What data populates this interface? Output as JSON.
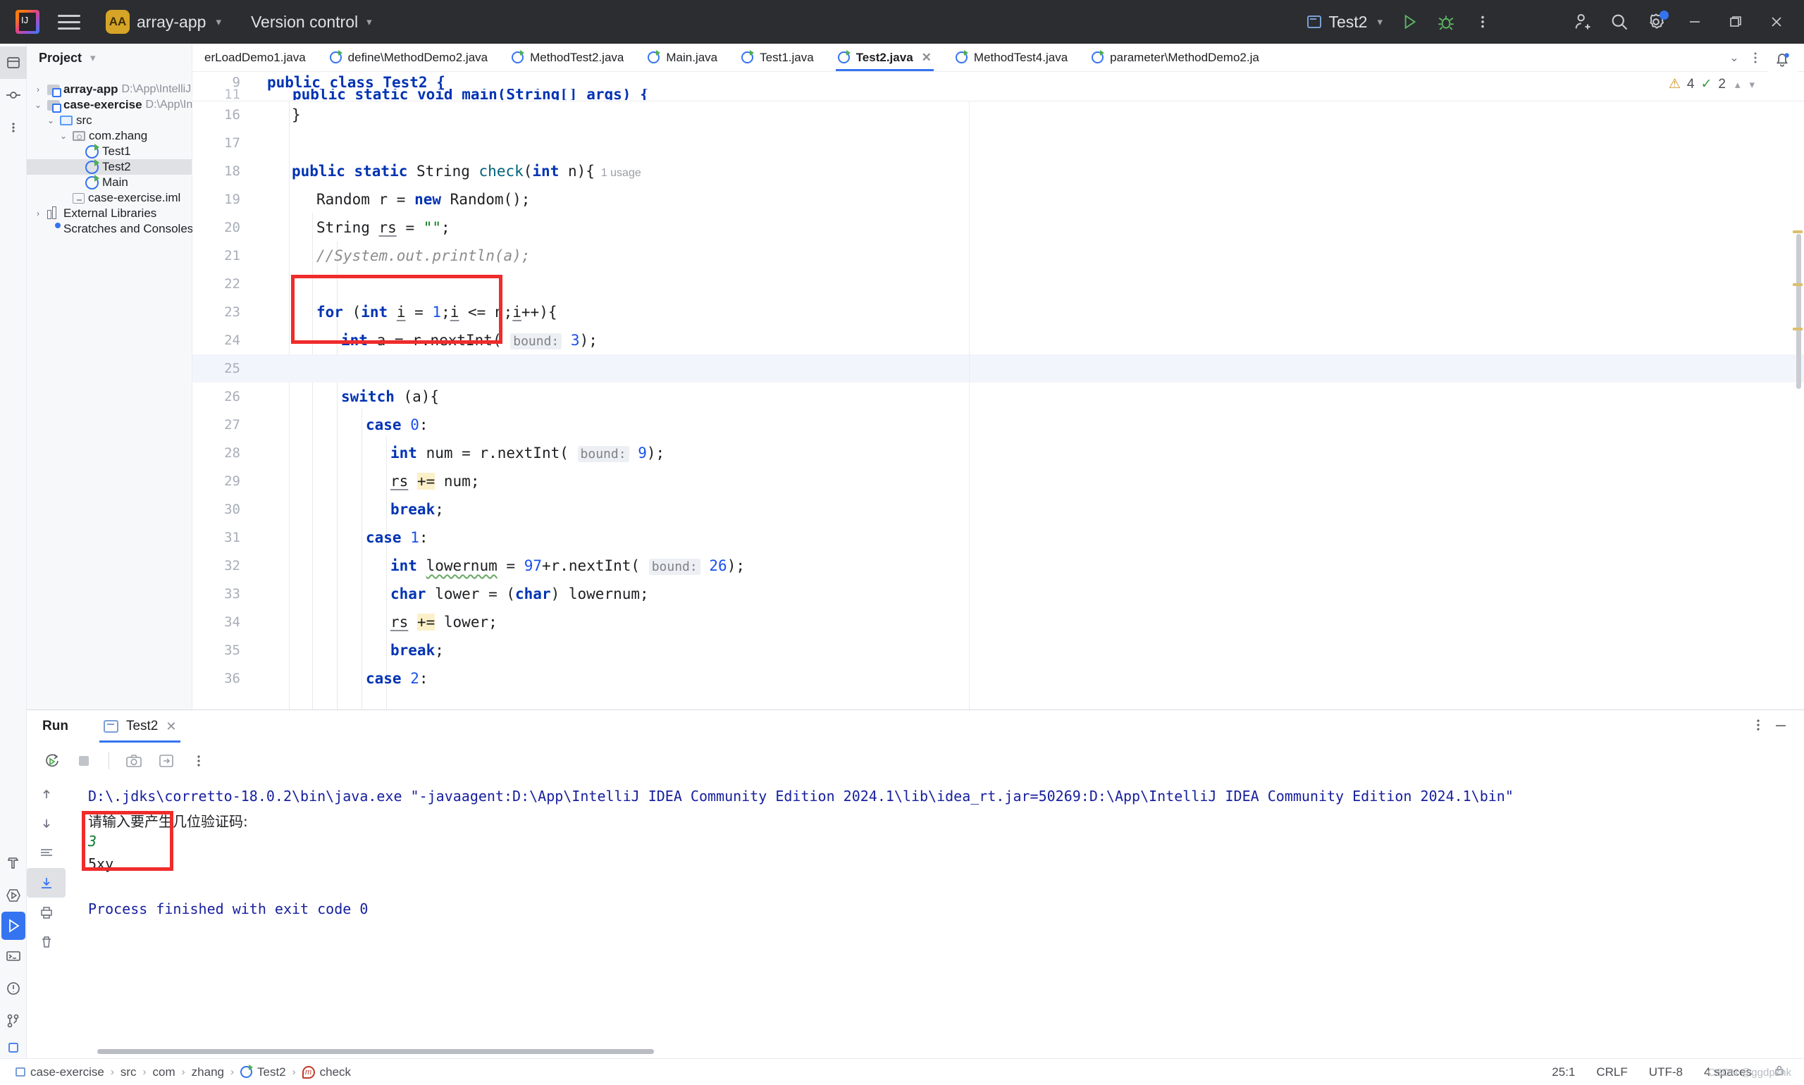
{
  "titlebar": {
    "logo_text": "IJ",
    "project_badge": "AA",
    "project_name": "array-app",
    "vcs_label": "Version control",
    "run_config": "Test2",
    "icons": [
      "burger-icon",
      "project-chevron-icon",
      "vcs-chevron-icon",
      "run-icon",
      "debug-icon",
      "more-vert-icon",
      "add-user-icon",
      "search-icon",
      "settings-icon",
      "minimize-icon",
      "restore-icon",
      "close-icon"
    ]
  },
  "project_panel": {
    "title": "Project",
    "tree": [
      {
        "label": "array-app",
        "path": "D:\\App\\IntelliJ IDEA C",
        "icon": "module-icon",
        "indent": 0,
        "arrow": "collapsed",
        "bold": true,
        "selected": false
      },
      {
        "label": "case-exercise",
        "path": "D:\\App\\IntelliJ IDE",
        "icon": "module-icon",
        "indent": 0,
        "arrow": "expanded",
        "bold": true,
        "selected": false
      },
      {
        "label": "src",
        "path": "",
        "icon": "source-folder-icon",
        "indent": 1,
        "arrow": "expanded",
        "bold": false,
        "selected": false
      },
      {
        "label": "com.zhang",
        "path": "",
        "icon": "package-icon",
        "indent": 2,
        "arrow": "expanded",
        "bold": false,
        "selected": false
      },
      {
        "label": "Test1",
        "path": "",
        "icon": "java-class-icon",
        "indent": 3,
        "arrow": "none",
        "bold": false,
        "selected": false
      },
      {
        "label": "Test2",
        "path": "",
        "icon": "java-class-icon",
        "indent": 3,
        "arrow": "none",
        "bold": false,
        "selected": true
      },
      {
        "label": "Main",
        "path": "",
        "icon": "java-class-icon",
        "indent": 3,
        "arrow": "none",
        "bold": false,
        "selected": false
      },
      {
        "label": "case-exercise.iml",
        "path": "",
        "icon": "iml-file-icon",
        "indent": 2,
        "arrow": "none",
        "bold": false,
        "selected": false
      },
      {
        "label": "External Libraries",
        "path": "",
        "icon": "library-icon",
        "indent": 0,
        "arrow": "collapsed",
        "bold": false,
        "selected": false
      },
      {
        "label": "Scratches and Consoles",
        "path": "",
        "icon": "scratches-icon",
        "indent": 0,
        "arrow": "none",
        "bold": false,
        "selected": false
      }
    ]
  },
  "editor_tabs": {
    "tabs": [
      {
        "label": "erLoadDemo1.java",
        "active": false,
        "closable": false,
        "icon": false
      },
      {
        "label": "define\\MethodDemo2.java",
        "active": false,
        "closable": false,
        "icon": true
      },
      {
        "label": "MethodTest2.java",
        "active": false,
        "closable": false,
        "icon": true
      },
      {
        "label": "Main.java",
        "active": false,
        "closable": false,
        "icon": true
      },
      {
        "label": "Test1.java",
        "active": false,
        "closable": false,
        "icon": true
      },
      {
        "label": "Test2.java",
        "active": true,
        "closable": true,
        "icon": true
      },
      {
        "label": "MethodTest4.java",
        "active": false,
        "closable": false,
        "icon": true
      },
      {
        "label": "parameter\\MethodDemo2.ja",
        "active": false,
        "closable": false,
        "icon": true
      }
    ],
    "overflow_icons": [
      "chevron-down-icon",
      "more-vert-icon"
    ],
    "notification_icon": "bell-icon"
  },
  "inspection_widget": {
    "warning_count": "4",
    "ok_count": "2",
    "up_icon": "chevron-up-icon",
    "down_icon": "chevron-down-icon"
  },
  "editor": {
    "sticky_line_number": "9",
    "sticky_code": "public class Test2 {",
    "clipped_line_number": "11",
    "clipped_code": "public static void main(String[] args) {",
    "lines": [
      {
        "n": "16",
        "indent": 1,
        "tokens": [
          {
            "t": "}",
            "c": ""
          }
        ]
      },
      {
        "n": "17",
        "indent": 1,
        "tokens": []
      },
      {
        "n": "18",
        "indent": 1,
        "tokens": [
          {
            "t": "public static ",
            "c": "k"
          },
          {
            "t": "String ",
            "c": "typ"
          },
          {
            "t": "check",
            "c": "mth"
          },
          {
            "t": "(",
            "c": ""
          },
          {
            "t": "int",
            "c": "k"
          },
          {
            "t": " n){",
            "c": ""
          },
          {
            "t": "  1 usage",
            "c": "usage"
          }
        ]
      },
      {
        "n": "19",
        "indent": 2,
        "tokens": [
          {
            "t": "Random r = ",
            "c": ""
          },
          {
            "t": "new",
            "c": "k"
          },
          {
            "t": " Random();",
            "c": ""
          }
        ]
      },
      {
        "n": "20",
        "indent": 2,
        "tokens": [
          {
            "t": "String ",
            "c": ""
          },
          {
            "t": "rs",
            "c": "und"
          },
          {
            "t": " = ",
            "c": ""
          },
          {
            "t": "\"\"",
            "c": "str"
          },
          {
            "t": ";",
            "c": ""
          }
        ]
      },
      {
        "n": "21",
        "indent": 2,
        "tokens": [
          {
            "t": "//System.out.println(a);",
            "c": "cmt"
          }
        ]
      },
      {
        "n": "22",
        "indent": 2,
        "tokens": []
      },
      {
        "n": "23",
        "indent": 2,
        "tokens": [
          {
            "t": "for",
            "c": "k"
          },
          {
            "t": " (",
            "c": ""
          },
          {
            "t": "int",
            "c": "k"
          },
          {
            "t": " ",
            "c": ""
          },
          {
            "t": "i",
            "c": "und"
          },
          {
            "t": " = ",
            "c": ""
          },
          {
            "t": "1",
            "c": "num"
          },
          {
            "t": ";",
            "c": ""
          },
          {
            "t": "i",
            "c": "und"
          },
          {
            "t": " <= n;",
            "c": ""
          },
          {
            "t": "i",
            "c": "und"
          },
          {
            "t": "++){",
            "c": ""
          }
        ]
      },
      {
        "n": "24",
        "indent": 3,
        "tokens": [
          {
            "t": "int",
            "c": "k"
          },
          {
            "t": " a = r.nextInt( ",
            "c": ""
          },
          {
            "t": "bound:",
            "c": "hint"
          },
          {
            "t": " ",
            "c": ""
          },
          {
            "t": "3",
            "c": "num"
          },
          {
            "t": ");",
            "c": ""
          }
        ]
      },
      {
        "n": "25",
        "indent": 3,
        "tokens": [],
        "current": true
      },
      {
        "n": "26",
        "indent": 3,
        "tokens": [
          {
            "t": "switch",
            "c": "k"
          },
          {
            "t": " (a){",
            "c": ""
          }
        ]
      },
      {
        "n": "27",
        "indent": 4,
        "tokens": [
          {
            "t": "case",
            "c": "k"
          },
          {
            "t": " ",
            "c": ""
          },
          {
            "t": "0",
            "c": "num"
          },
          {
            "t": ":",
            "c": ""
          }
        ]
      },
      {
        "n": "28",
        "indent": 5,
        "tokens": [
          {
            "t": "int",
            "c": "k"
          },
          {
            "t": " num = r.nextInt( ",
            "c": ""
          },
          {
            "t": "bound:",
            "c": "hint"
          },
          {
            "t": " ",
            "c": ""
          },
          {
            "t": "9",
            "c": "num"
          },
          {
            "t": ");",
            "c": ""
          }
        ]
      },
      {
        "n": "29",
        "indent": 5,
        "tokens": [
          {
            "t": "rs",
            "c": "und"
          },
          {
            "t": " ",
            "c": ""
          },
          {
            "t": "+=",
            "c": "hl"
          },
          {
            "t": " num;",
            "c": ""
          }
        ]
      },
      {
        "n": "30",
        "indent": 5,
        "tokens": [
          {
            "t": "break",
            "c": "k"
          },
          {
            "t": ";",
            "c": ""
          }
        ]
      },
      {
        "n": "31",
        "indent": 4,
        "tokens": [
          {
            "t": "case",
            "c": "k"
          },
          {
            "t": " ",
            "c": ""
          },
          {
            "t": "1",
            "c": "num"
          },
          {
            "t": ":",
            "c": ""
          }
        ]
      },
      {
        "n": "32",
        "indent": 5,
        "tokens": [
          {
            "t": "int",
            "c": "k"
          },
          {
            "t": " ",
            "c": ""
          },
          {
            "t": "lowernum",
            "c": "squig"
          },
          {
            "t": " = ",
            "c": ""
          },
          {
            "t": "97",
            "c": "num"
          },
          {
            "t": "+r.nextInt( ",
            "c": ""
          },
          {
            "t": "bound:",
            "c": "hint"
          },
          {
            "t": " ",
            "c": ""
          },
          {
            "t": "26",
            "c": "num"
          },
          {
            "t": ");",
            "c": ""
          }
        ]
      },
      {
        "n": "33",
        "indent": 5,
        "tokens": [
          {
            "t": "char",
            "c": "k"
          },
          {
            "t": " lower = (",
            "c": ""
          },
          {
            "t": "char",
            "c": "k"
          },
          {
            "t": ") lowernum;",
            "c": ""
          }
        ]
      },
      {
        "n": "34",
        "indent": 5,
        "tokens": [
          {
            "t": "rs",
            "c": "und"
          },
          {
            "t": " ",
            "c": ""
          },
          {
            "t": "+=",
            "c": "hl"
          },
          {
            "t": " lower;",
            "c": ""
          }
        ]
      },
      {
        "n": "35",
        "indent": 5,
        "tokens": [
          {
            "t": "break",
            "c": "k"
          },
          {
            "t": ";",
            "c": ""
          }
        ]
      },
      {
        "n": "36",
        "indent": 4,
        "tokens": [
          {
            "t": "case",
            "c": "k"
          },
          {
            "t": " ",
            "c": ""
          },
          {
            "t": "2",
            "c": "num"
          },
          {
            "t": ":",
            "c": ""
          }
        ]
      }
    ],
    "annotation_box_label": "for-loop-highlight-box"
  },
  "run_panel": {
    "title": "Run",
    "tab_label": "Test2",
    "tab_close_icon": "close-icon",
    "header_icons": [
      "more-vert-icon",
      "minimize-icon"
    ],
    "toolbar_icons": [
      "rerun-icon",
      "stop-icon",
      "screenshot-icon",
      "export-icon",
      "more-vert-icon"
    ],
    "gutter_icons": [
      "scroll-up-icon",
      "scroll-down-icon",
      "soft-wrap-icon",
      "print-icon",
      "trash-icon"
    ],
    "console": [
      {
        "text": "D:\\.jdks\\corretto-18.0.2\\bin\\java.exe \"-javaagent:D:\\App\\IntelliJ IDEA Community Edition 2024.1\\lib\\idea_rt.jar=50269:D:\\App\\IntelliJ IDEA Community Edition 2024.1\\bin\"",
        "style": "blue"
      },
      {
        "text": "请输入要产生几位验证码:",
        "style": "cjk"
      },
      {
        "text": "3",
        "style": "green"
      },
      {
        "text": "5xy",
        "style": "plain"
      },
      {
        "text": "",
        "style": "plain"
      },
      {
        "text": "Process finished with exit code 0",
        "style": "blue"
      }
    ],
    "annotation_box_label": "console-output-highlight-box"
  },
  "status_bar": {
    "breadcrumbs": [
      {
        "label": "case-exercise",
        "icon": "module-icon"
      },
      {
        "label": "src",
        "icon": "none"
      },
      {
        "label": "com",
        "icon": "none"
      },
      {
        "label": "zhang",
        "icon": "none"
      },
      {
        "label": "Test2",
        "icon": "java-class-icon"
      },
      {
        "label": "check",
        "icon": "method-icon"
      }
    ],
    "caret": "25:1",
    "line_sep": "CRLF",
    "encoding": "UTF-8",
    "indent": "4 spaces",
    "lock_icon": "lock-icon",
    "watermark": "CSDN @ggdpzhk"
  },
  "left_rail": {
    "top_icons": [
      "project-icon",
      "commit-icon",
      "more-vert-icon"
    ],
    "bottom_icons": [
      "build-icon",
      "run-anything-icon",
      "run-icon",
      "terminal-icon",
      "problems-icon",
      "git-icon",
      "services-icon"
    ]
  },
  "colors": {
    "accent": "#3574f0",
    "annotation_red": "#f02b2b",
    "titlebar_bg": "#2b2d30",
    "panel_bg": "#f7f8fa",
    "keyword": "#0033b3",
    "string": "#067d17",
    "number": "#1750eb",
    "comment": "#8c8c8c",
    "console_blue": "#17209e",
    "console_green": "#0b7a2f",
    "selection": "#dfe1e5"
  }
}
